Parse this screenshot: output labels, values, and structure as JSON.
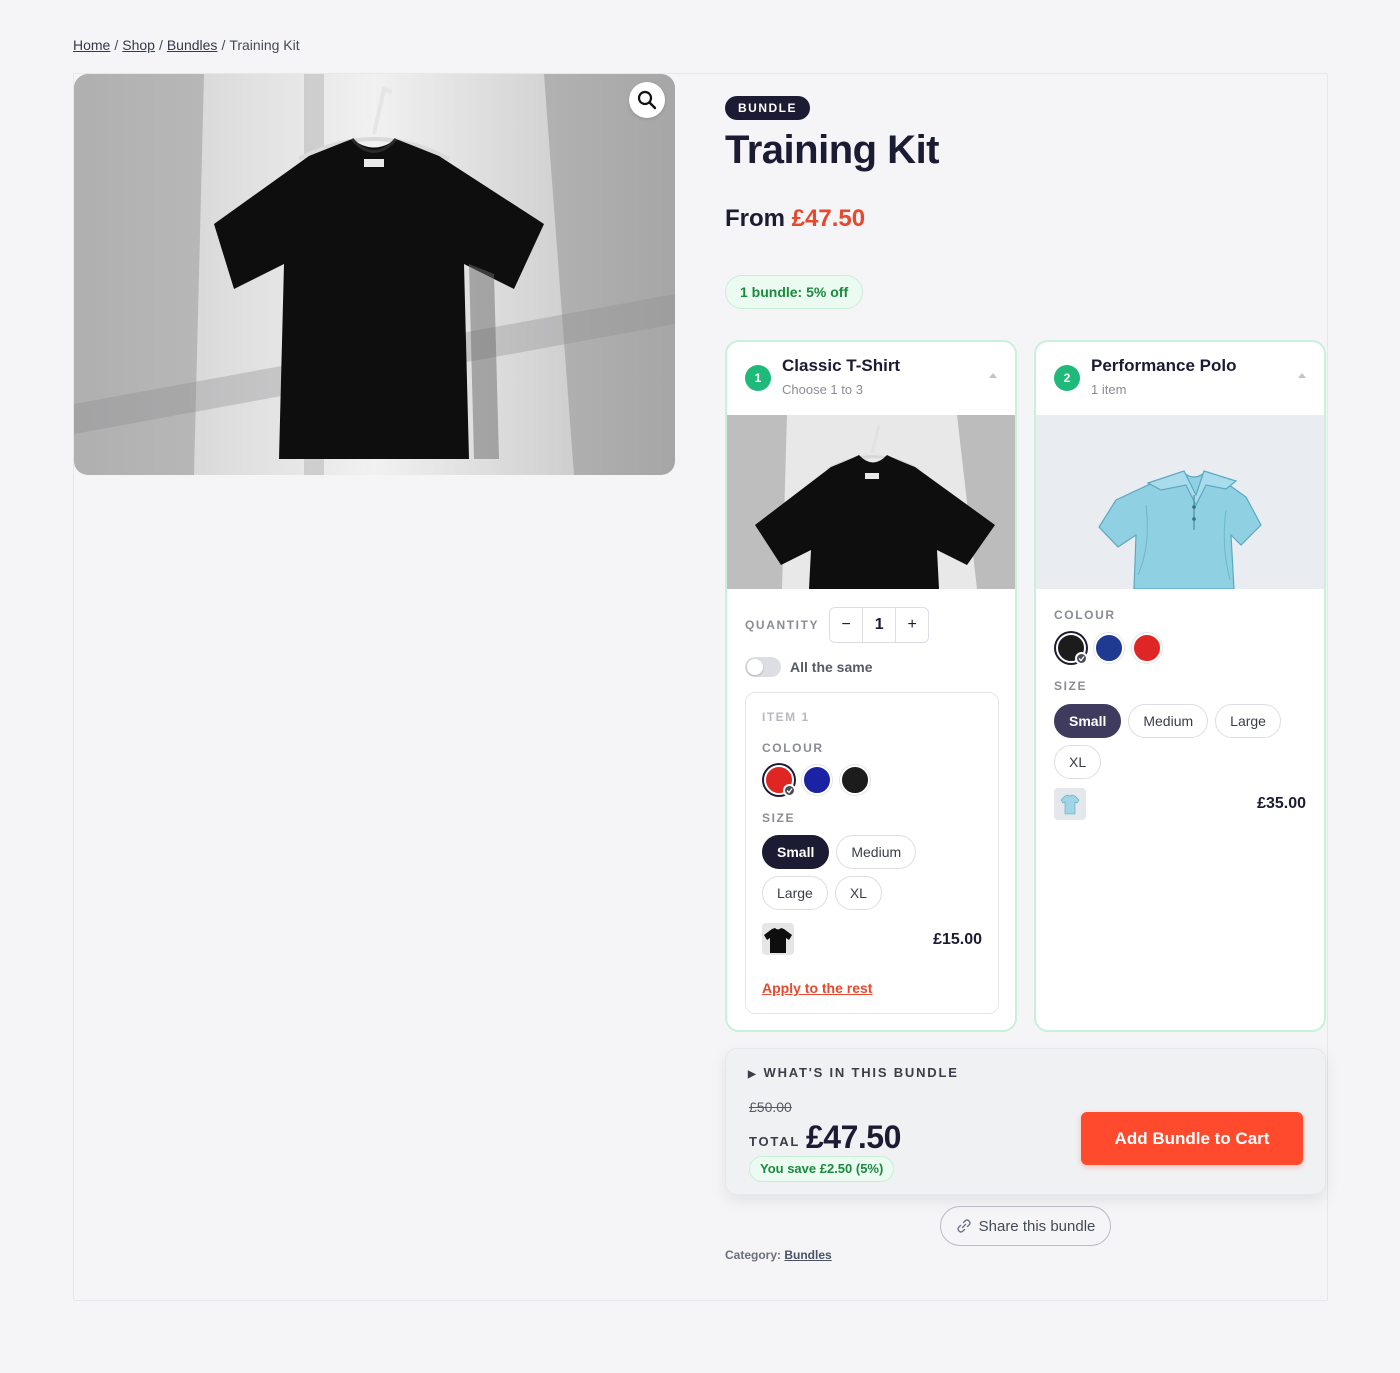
{
  "breadcrumb": {
    "items": [
      "Home",
      "Shop",
      "Bundles"
    ],
    "current": "Training Kit",
    "separator": "/"
  },
  "product": {
    "badge": "BUNDLE",
    "title": "Training Kit",
    "from_label": "From",
    "from_price": "£47.50",
    "discount_pill": "1 bundle: 5% off"
  },
  "cards": [
    {
      "step": "1",
      "title": "Classic T-Shirt",
      "subtitle": "Choose 1 to 3",
      "quantity_label": "QUANTITY",
      "quantity_value": "1",
      "minus": "−",
      "plus": "+",
      "toggle_label": "All the same",
      "item_label": "ITEM 1",
      "colour_label": "COLOUR",
      "swatches": [
        "#e02525",
        "#1b22a3",
        "#1c1c1c"
      ],
      "selected_swatch": "#e02525",
      "size_label": "SIZE",
      "sizes": [
        "Small",
        "Medium",
        "Large",
        "XL"
      ],
      "selected_size": "Small",
      "line_price": "£15.00",
      "apply_link": "Apply to the rest"
    },
    {
      "step": "2",
      "title": "Performance Polo",
      "subtitle": "1 item",
      "colour_label": "COLOUR",
      "swatches": [
        "#1c1c1c",
        "#1f3a91",
        "#e02525"
      ],
      "selected_swatch": "#1c1c1c",
      "size_label": "SIZE",
      "sizes": [
        "Small",
        "Medium",
        "Large",
        "XL"
      ],
      "selected_size": "Small",
      "line_price": "£35.00"
    }
  ],
  "summary": {
    "toggle": "WHAT'S IN THIS BUNDLE",
    "old_price": "£50.00",
    "total_label": "TOTAL",
    "total": "£47.50",
    "savings": "You save £2.50 (5%)",
    "cta": "Add Bundle to Cart"
  },
  "share": {
    "label": "Share this bundle",
    "icon": "link-icon"
  },
  "category": {
    "label": "Category:",
    "value": "Bundles"
  },
  "colors": {
    "accent": "#ff4a2e",
    "price_accent": "#e8482e",
    "navy": "#1b1b34",
    "step_green": "#1fb979",
    "card_border": "#c8f0db",
    "savings_green": "#1a8a3f"
  }
}
